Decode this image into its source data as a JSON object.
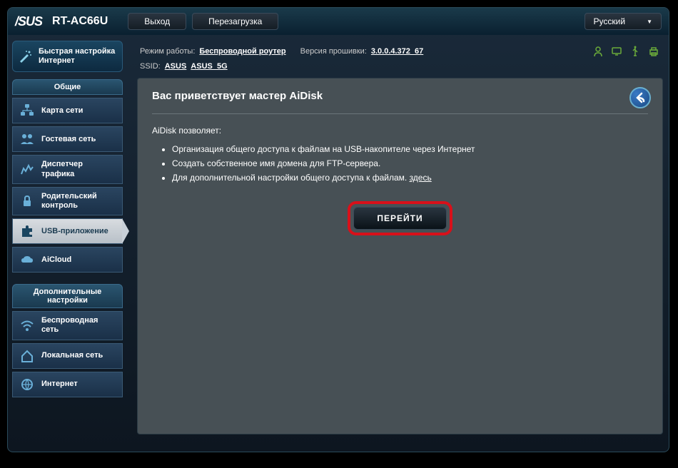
{
  "header": {
    "brand": "/SUS",
    "model": "RT-AC66U",
    "logout": "Выход",
    "reboot": "Перезагрузка",
    "language": "Русский"
  },
  "info": {
    "mode_label": "Режим работы:",
    "mode_value": "Беспроводной роутер",
    "fw_label": "Версия прошивки:",
    "fw_value": "3.0.0.4.372_67",
    "ssid_label": "SSID:",
    "ssid_1": "ASUS",
    "ssid_2": "ASUS_5G"
  },
  "sidebar": {
    "quick_setup": "Быстрая настройка Интернет",
    "section_general": "Общие",
    "items_general": [
      "Карта сети",
      "Гостевая сеть",
      "Диспетчер трафика",
      "Родительский контроль",
      "USB-приложение",
      "AiCloud"
    ],
    "section_advanced": "Дополнительные настройки",
    "items_advanced": [
      "Беспроводная сеть",
      "Локальная сеть",
      "Интернет"
    ]
  },
  "panel": {
    "title": "Вас приветствует мастер AiDisk",
    "intro": "AiDisk позволяет:",
    "bullets": [
      "Организация общего доступа к файлам на USB-накопителе через Интернет",
      "Создать собственное имя домена для FTP-сервера.",
      "Для дополнительной настройки общего доступа к файлам. "
    ],
    "here_link": "здесь",
    "go_button": "ПЕРЕЙТИ"
  }
}
